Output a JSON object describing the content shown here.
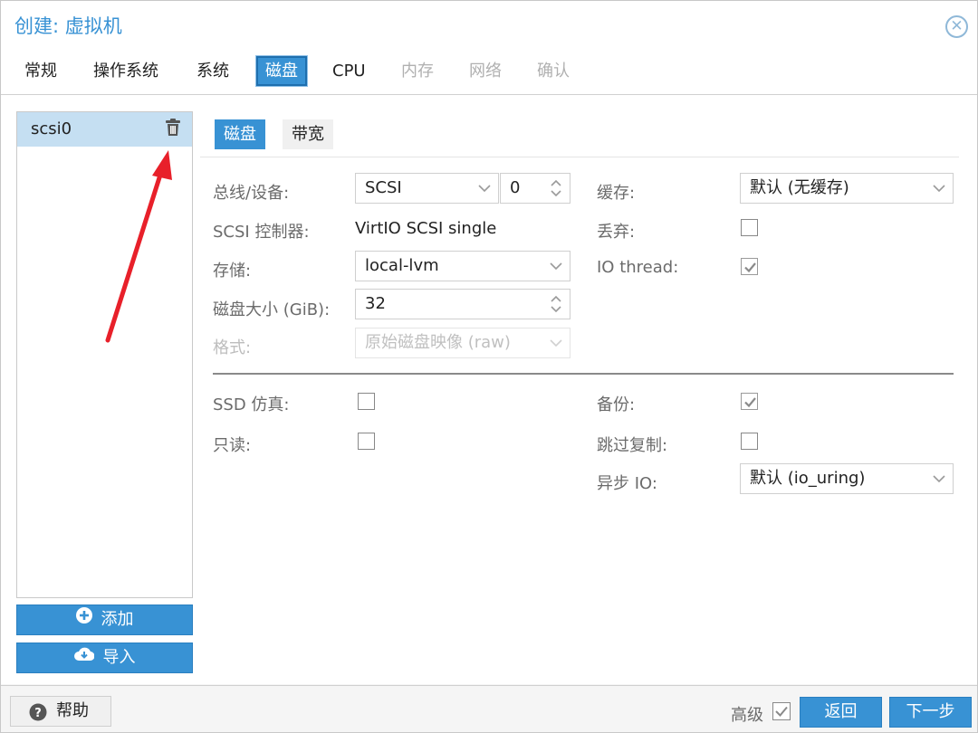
{
  "dialog": {
    "title": "创建: 虚拟机",
    "close_icon": "close-circle-icon"
  },
  "tabs": [
    {
      "label": "常规",
      "state": "enabled"
    },
    {
      "label": "操作系统",
      "state": "enabled"
    },
    {
      "label": "系统",
      "state": "enabled"
    },
    {
      "label": "磁盘",
      "state": "active"
    },
    {
      "label": "CPU",
      "state": "enabled"
    },
    {
      "label": "内存",
      "state": "disabled"
    },
    {
      "label": "网络",
      "state": "disabled"
    },
    {
      "label": "确认",
      "state": "disabled"
    }
  ],
  "disks": {
    "items": [
      {
        "label": "scsi0",
        "icon": "trash-icon"
      }
    ],
    "add_label": "添加",
    "import_label": "导入"
  },
  "subtabs": [
    {
      "label": "磁盘",
      "active": true
    },
    {
      "label": "带宽",
      "active": false
    }
  ],
  "form": {
    "bus_label": "总线/设备:",
    "bus_value": "SCSI",
    "device_value": "0",
    "controller_label": "SCSI 控制器:",
    "controller_value": "VirtIO SCSI single",
    "storage_label": "存储:",
    "storage_value": "local-lvm",
    "size_label": "磁盘大小 (GiB):",
    "size_value": "32",
    "format_label": "格式:",
    "format_value": "原始磁盘映像 (raw)",
    "cache_label": "缓存:",
    "cache_value": "默认 (无缓存)",
    "discard_label": "丢弃:",
    "discard_checked": false,
    "iothread_label": "IO thread:",
    "iothread_checked": true,
    "ssd_label": "SSD 仿真:",
    "ssd_checked": false,
    "readonly_label": "只读:",
    "readonly_checked": false,
    "backup_label": "备份:",
    "backup_checked": true,
    "skip_replication_label": "跳过复制:",
    "skip_replication_checked": false,
    "async_io_label": "异步 IO:",
    "async_io_value": "默认 (io_uring)"
  },
  "footer": {
    "help_label": "帮助",
    "advanced_label": "高级",
    "advanced_checked": true,
    "back_label": "返回",
    "next_label": "下一步"
  },
  "colors": {
    "accent": "#3892d4",
    "annotation_arrow": "#e8202a"
  }
}
